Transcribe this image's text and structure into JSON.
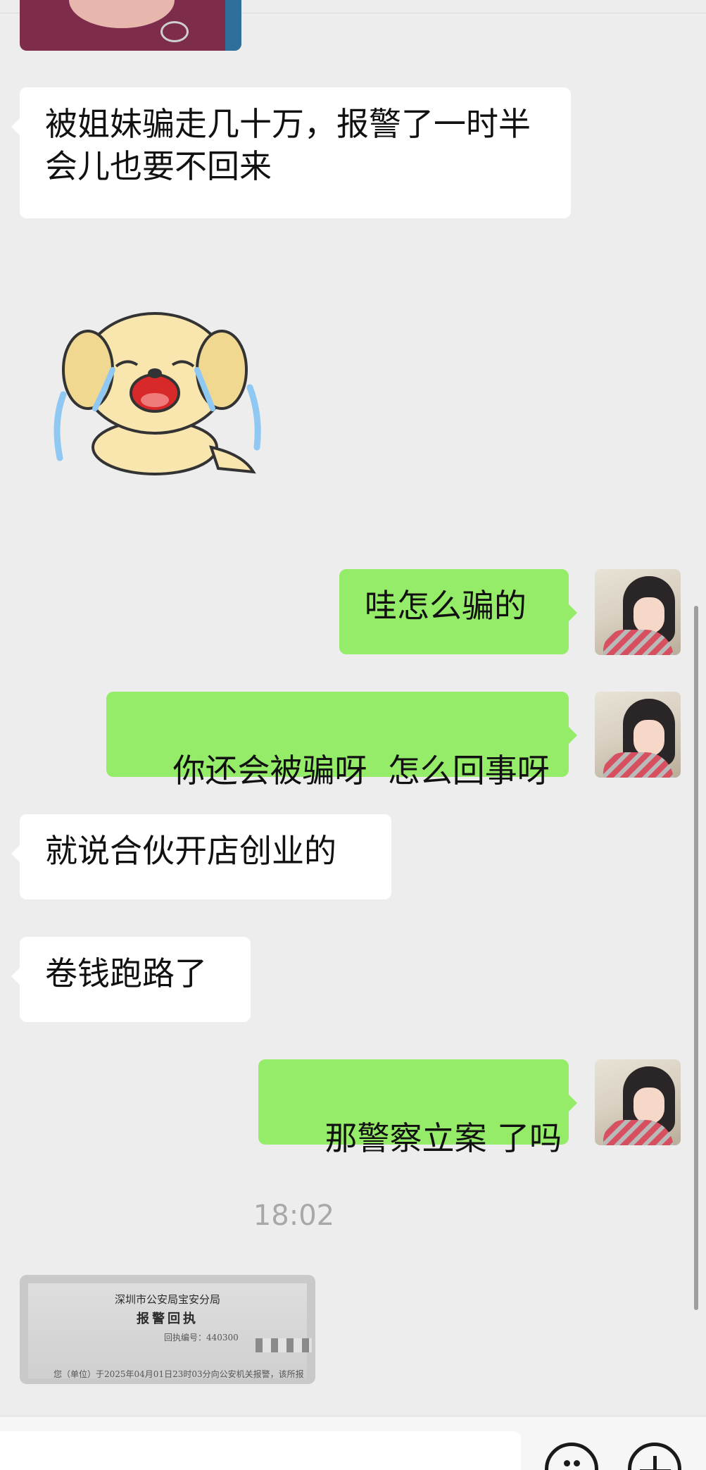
{
  "messages": [
    {
      "side": "in",
      "text": "被姐妹骗走几十万，报警了一时半会儿也要不回来"
    },
    {
      "side": "in",
      "type": "sticker",
      "sticker_icon": "crying-dog-sticker"
    },
    {
      "side": "out",
      "text": "哇怎么骗的"
    },
    {
      "side": "out",
      "text": "你还会被骗呀  怎么回事呀"
    },
    {
      "side": "in",
      "text": "就说合伙开店创业的"
    },
    {
      "side": "in",
      "text": "卷钱跑路了"
    },
    {
      "side": "out",
      "text": "那警察立案 了吗"
    }
  ],
  "timestamp": "18:02",
  "document": {
    "title_line1": "深圳市公安局宝安分局",
    "title_line2": "报警回执",
    "receipt_number": "回执编号：440300",
    "body": "您（单位）于2025年04月01日23时03分向公安机关报警，该所报"
  },
  "colors": {
    "sent_bubble": "#95ec69",
    "received_bubble": "#ffffff",
    "background": "#ededed"
  },
  "icons": {
    "emoji": "emoji-smile-icon",
    "more": "plus-icon"
  }
}
